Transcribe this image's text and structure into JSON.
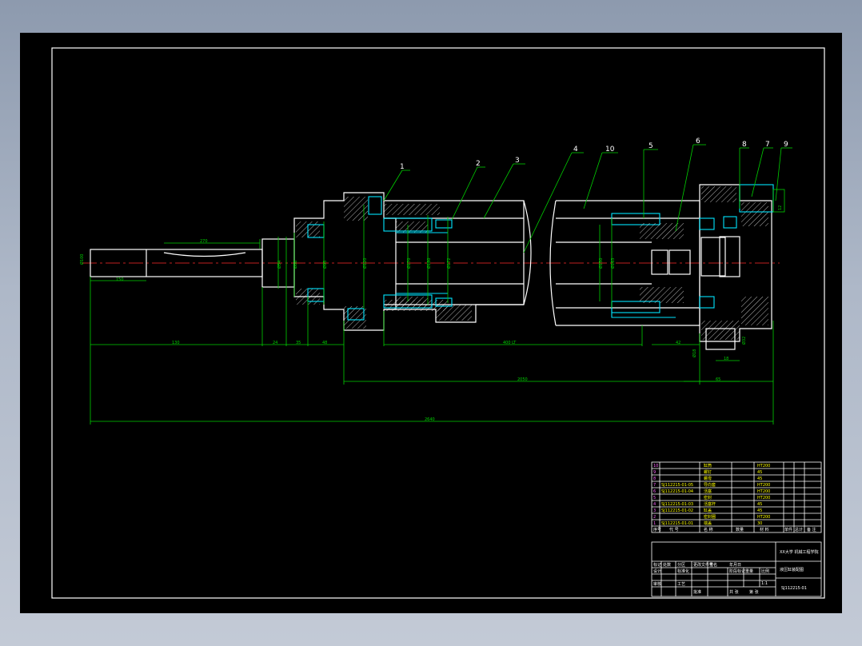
{
  "part_numbers": [
    "1",
    "2",
    "3",
    "4",
    "10",
    "5",
    "6",
    "8",
    "7",
    "9"
  ],
  "dims": {
    "d_rod": "Ø100",
    "len_rod": "150",
    "len_1": "270",
    "d1": "Ø54",
    "d2": "Ø88",
    "d3": "Ø95",
    "d4": "Ø120",
    "d5": "Ø170",
    "d6": "Ø180",
    "d7": "Ø172",
    "d8": "Ø150",
    "d9": "Ø163",
    "a1": "130",
    "a2": "24",
    "a3": "35",
    "a4": "48",
    "stroke": "400 LT",
    "mid": "2050",
    "overall": "2640",
    "r1": "42",
    "r2": "18",
    "r3": "65",
    "r4": "Ø18",
    "r5": "Ø32",
    "r6": "12"
  },
  "bom": {
    "rows": [
      {
        "no": "10",
        "code": "",
        "name": "缸筒",
        "qty": "",
        "mat": "HT200"
      },
      {
        "no": "9",
        "code": "",
        "name": "螺钉",
        "qty": "",
        "mat": "45"
      },
      {
        "no": "8",
        "code": "",
        "name": "螺母",
        "qty": "",
        "mat": "45"
      },
      {
        "no": "7",
        "code": "SJ112215-01-05",
        "name": "导向套",
        "qty": "",
        "mat": "HT200"
      },
      {
        "no": "6",
        "code": "SJ112215-01-04",
        "name": "活塞",
        "qty": "",
        "mat": "HT200"
      },
      {
        "no": "5",
        "code": "",
        "name": "密封",
        "qty": "",
        "mat": "HT200"
      },
      {
        "no": "4",
        "code": "SJ112215-01-03",
        "name": "活塞杆",
        "qty": "",
        "mat": "45"
      },
      {
        "no": "3",
        "code": "SJ112215-01-02",
        "name": "缸盖",
        "qty": "",
        "mat": "45"
      },
      {
        "no": "2",
        "code": "",
        "name": "密封圈",
        "qty": "",
        "mat": "HT200"
      },
      {
        "no": "1",
        "code": "SJ112215-01-01",
        "name": "端盖",
        "qty": "",
        "mat": "30"
      }
    ],
    "header": {
      "no": "序号",
      "code": "代 号",
      "name": "名 称",
      "qty": "数量",
      "mat": "材 料",
      "wt1": "单件",
      "wt2": "总计",
      "note": "备 注"
    }
  },
  "title_block": {
    "school": "XX大学 机械工程学院",
    "drawing_name": "液压缸装配图",
    "drawing_no": "SJ112215-01",
    "labels": [
      "标记",
      "处数",
      "分区",
      "更改文件号",
      "签名",
      "年月日",
      "设计",
      "标准化",
      "阶段标记",
      "重量",
      "比例",
      "审核",
      "工艺",
      "批准",
      "共 张",
      "第 张"
    ],
    "scale": "1:1"
  }
}
